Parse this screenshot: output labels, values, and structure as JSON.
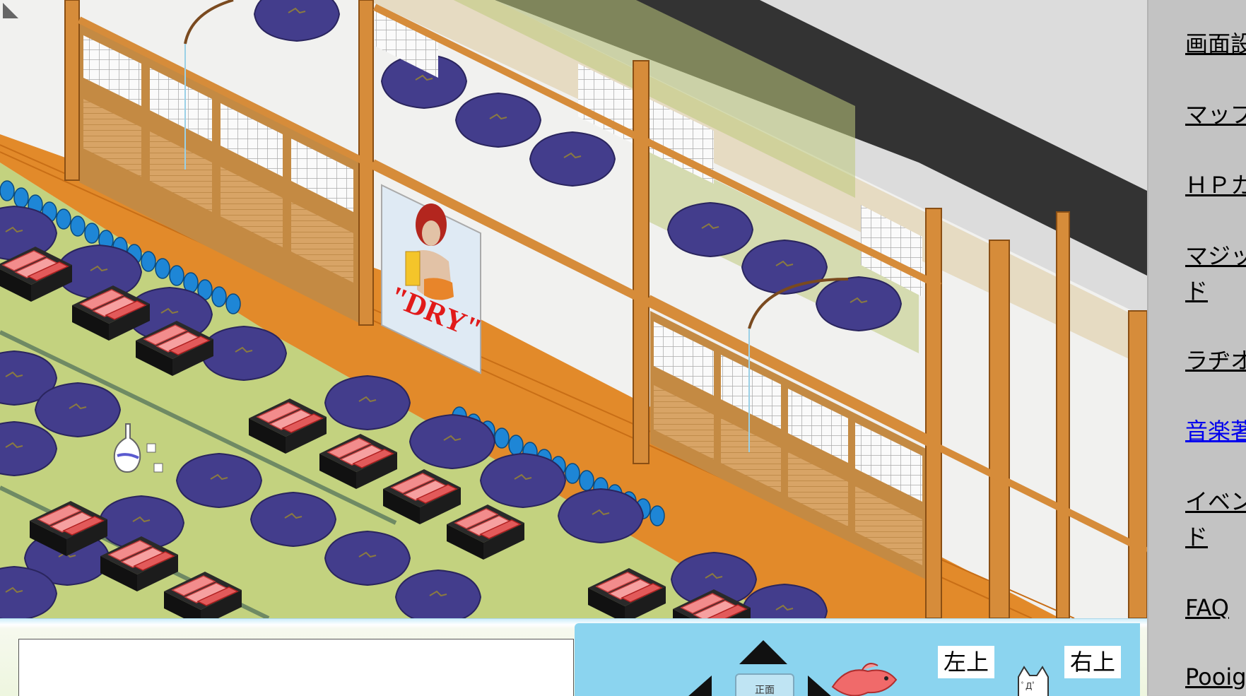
{
  "scene": {
    "poster_text": "\"DRY\""
  },
  "controls": {
    "center_label": "正面",
    "upper_left_label": "左上",
    "upper_right_label": "右上",
    "cat_face": "ﾟДﾟ"
  },
  "sidebar": {
    "items": [
      {
        "label": "画面設"
      },
      {
        "label": "マップ"
      },
      {
        "label": "ＨＰカ"
      },
      {
        "label": "マジッ"
      },
      {
        "label": "ド"
      },
      {
        "label": "ラヂオ"
      },
      {
        "label": "音楽著"
      },
      {
        "label": "イベン"
      },
      {
        "label": "ド"
      },
      {
        "label": "FAQ"
      },
      {
        "label": "Pooig"
      }
    ]
  },
  "colors": {
    "floor_wood": "#e28a2a",
    "tatami": "#c3d27f",
    "cushion": "#433d8c",
    "roof": "#333333",
    "panel_blue": "#8bd4ef",
    "link_blue": "#0000ee"
  }
}
